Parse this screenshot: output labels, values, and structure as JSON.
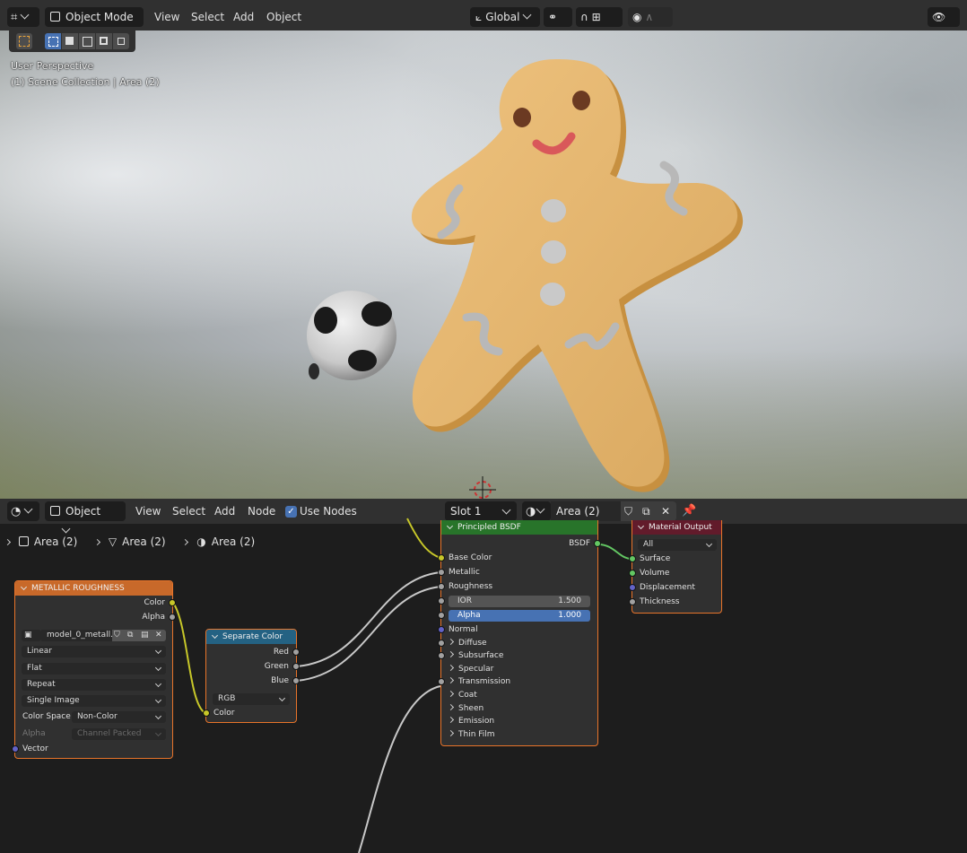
{
  "viewport": {
    "header": {
      "mode_label": "Object Mode",
      "menus": [
        "View",
        "Select",
        "Add",
        "Object"
      ],
      "transform_orientation": "Global"
    },
    "overlay": {
      "perspective": "User Perspective",
      "collection": "(1) Scene Collection | Area (2)"
    }
  },
  "node_editor": {
    "header": {
      "type_label": "Object",
      "menus": [
        "View",
        "Select",
        "Add",
        "Node"
      ],
      "use_nodes_label": "Use Nodes",
      "use_nodes_checked": true,
      "slot_label": "Slot 1",
      "material_name": "Area (2)"
    },
    "breadcrumbs": [
      "Area (2)",
      "Area (2)",
      "Area (2)"
    ],
    "nodes": {
      "metallic_roughness": {
        "title": "METALLIC ROUGHNESS",
        "outputs": [
          "Color",
          "Alpha"
        ],
        "image_name": "model_0_metall...",
        "interpolation": "Linear",
        "projection": "Flat",
        "extension": "Repeat",
        "source": "Single Image",
        "color_space_label": "Color Space",
        "color_space_value": "Non-Color",
        "alpha_label": "Alpha",
        "alpha_value": "Channel Packed",
        "input": "Vector"
      },
      "separate_color": {
        "title": "Separate Color",
        "outputs": [
          "Red",
          "Green",
          "Blue"
        ],
        "mode": "RGB",
        "input": "Color"
      },
      "principled_bsdf": {
        "title": "Principled BSDF",
        "output": "BSDF",
        "inputs": [
          "Base Color",
          "Metallic",
          "Roughness"
        ],
        "ior_label": "IOR",
        "ior_value": "1.500",
        "alpha_label": "Alpha",
        "alpha_value": "1.000",
        "normal": "Normal",
        "panels": [
          "Diffuse",
          "Subsurface",
          "Specular",
          "Transmission",
          "Coat",
          "Sheen",
          "Emission",
          "Thin Film"
        ]
      },
      "material_output": {
        "title": "Material Output",
        "target": "All",
        "inputs": [
          "Surface",
          "Volume",
          "Displacement",
          "Thickness"
        ]
      }
    }
  },
  "colors": {
    "header_bg": "#303030",
    "node_bg": "#303030",
    "texture_header": "#c8692a",
    "color_header": "#246283",
    "shader_header": "#28742a",
    "output_header": "#621b2b",
    "selection_outline": "#e8742a",
    "alpha_highlight": "#4772b3"
  }
}
